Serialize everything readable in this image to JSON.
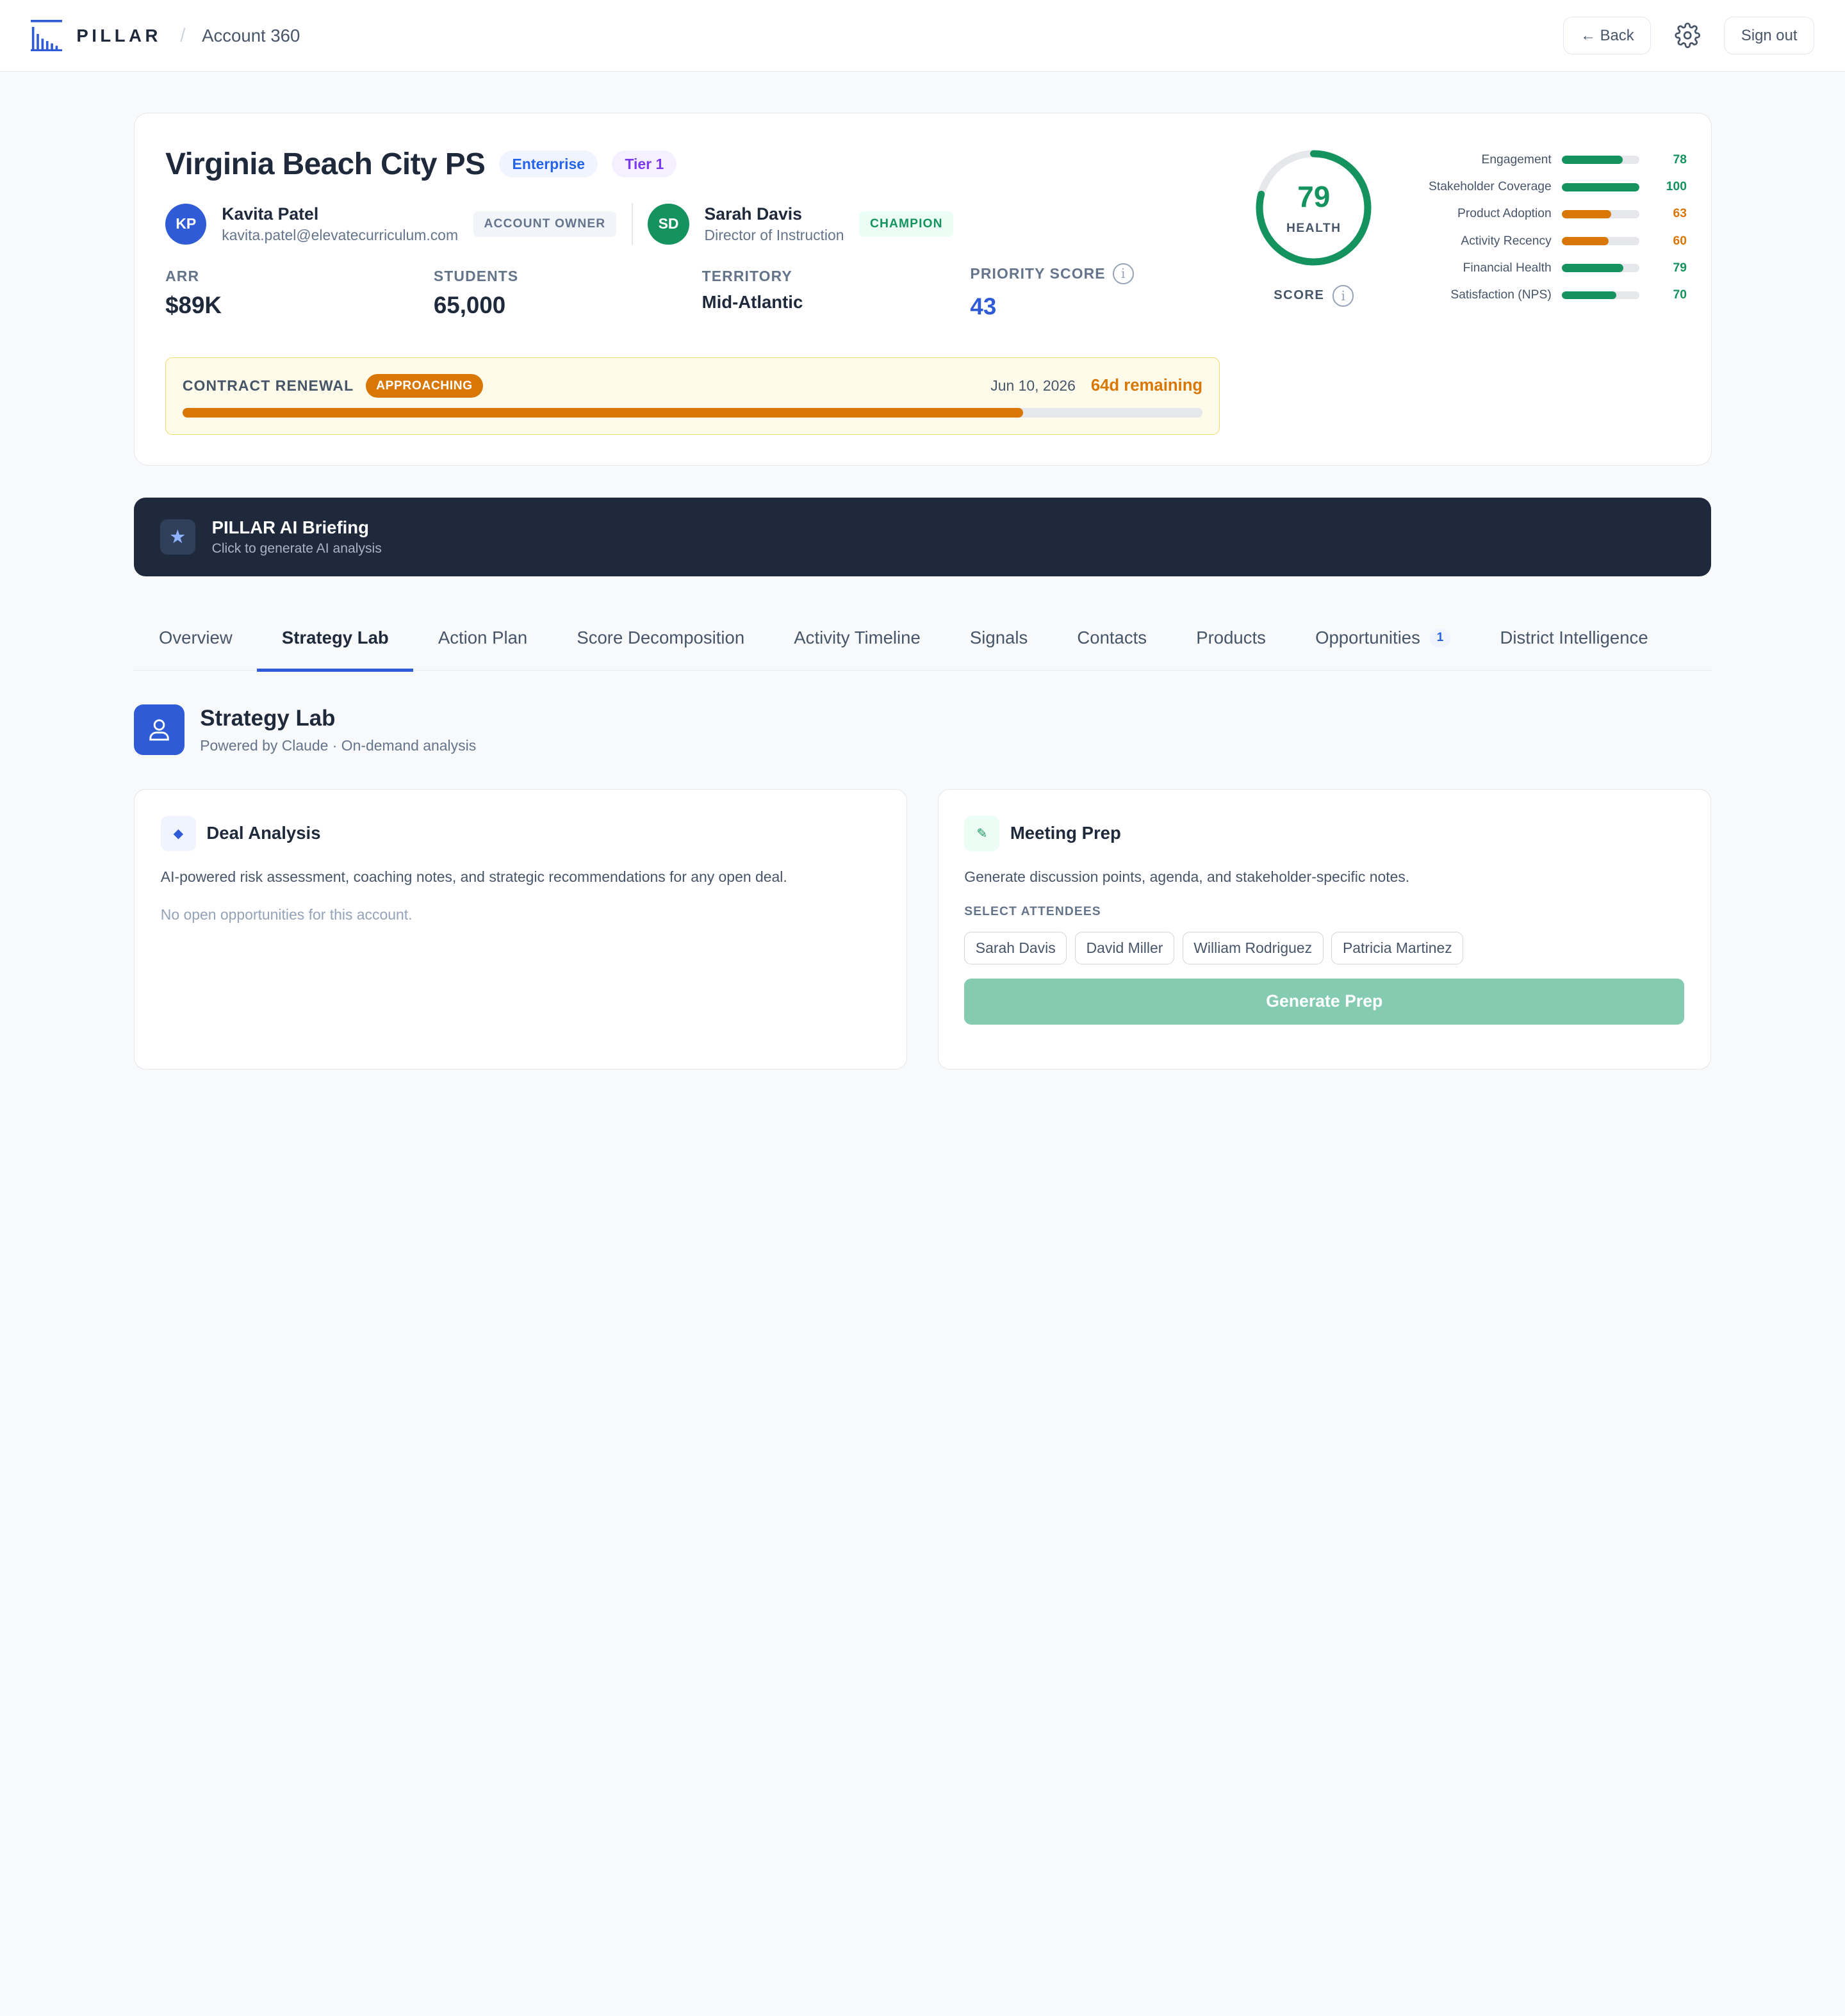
{
  "header": {
    "brand": "PILLAR",
    "separator": "/",
    "breadcrumb": "Account 360",
    "back_label": "← Back",
    "sign_out_label": "Sign out"
  },
  "account": {
    "name": "Virginia Beach City PS",
    "tags": [
      "Enterprise",
      "Tier 1"
    ],
    "owner": {
      "initials": "KP",
      "name": "Kavita Patel",
      "email": "kavita.patel@elevatecurriculum.com",
      "role": "ACCOUNT OWNER"
    },
    "champion": {
      "initials": "SD",
      "name": "Sarah Davis",
      "title": "Director of Instruction",
      "role": "CHAMPION"
    },
    "metrics": {
      "arr_label": "ARR",
      "arr": "$89K",
      "students_label": "STUDENTS",
      "students": "65,000",
      "territory_label": "TERRITORY",
      "territory": "Mid-Atlantic",
      "priority_label": "PRIORITY SCORE",
      "priority": "43"
    },
    "renewal": {
      "label": "CONTRACT RENEWAL",
      "status": "APPROACHING",
      "date": "Jun 10, 2026",
      "remaining": "64d remaining",
      "progress": 0.824
    },
    "health": {
      "score": "79",
      "label": "HEALTH",
      "caption": "SCORE",
      "value": 79,
      "color": "#15935e"
    },
    "factors": [
      {
        "name": "Engagement",
        "value": "78",
        "level": 78,
        "color": "#15935e"
      },
      {
        "name": "Stakeholder Coverage",
        "value": "100",
        "level": 100,
        "color": "#15935e"
      },
      {
        "name": "Product Adoption",
        "value": "63",
        "level": 63,
        "color": "#d97706"
      },
      {
        "name": "Activity Recency",
        "value": "60",
        "level": 60,
        "color": "#d97706"
      },
      {
        "name": "Financial Health",
        "value": "79",
        "level": 79,
        "color": "#15935e"
      },
      {
        "name": "Satisfaction (NPS)",
        "value": "70",
        "level": 70,
        "color": "#15935e"
      }
    ]
  },
  "ai_briefing": {
    "title": "PILLAR AI Briefing",
    "subtitle": "Click to generate AI analysis",
    "icon": "star-icon"
  },
  "tabs": [
    {
      "label": "Overview",
      "active": false
    },
    {
      "label": "Strategy Lab",
      "active": true
    },
    {
      "label": "Action Plan",
      "active": false
    },
    {
      "label": "Score Decomposition",
      "active": false
    },
    {
      "label": "Activity Timeline",
      "active": false
    },
    {
      "label": "Signals",
      "active": false
    },
    {
      "label": "Contacts",
      "active": false
    },
    {
      "label": "Products",
      "active": false
    },
    {
      "label": "Opportunities",
      "active": false,
      "count": "1"
    },
    {
      "label": "District Intelligence",
      "active": false
    }
  ],
  "strategy_lab": {
    "title": "Strategy Lab",
    "subtitle": "Powered by Claude · On-demand analysis",
    "deal_analysis": {
      "title": "Deal Analysis",
      "description": "AI-powered risk assessment, coaching notes, and strategic recommendations for any open deal.",
      "empty": "No open opportunities for this account."
    },
    "meeting_prep": {
      "title": "Meeting Prep",
      "description": "Generate discussion points, agenda, and stakeholder-specific notes.",
      "attendees_label": "SELECT ATTENDEES",
      "attendees": [
        "Sarah Davis",
        "David Miller",
        "William Rodriguez",
        "Patricia Martinez"
      ],
      "button_label": "Generate Prep"
    }
  },
  "colors": {
    "accent": "#2f5bd6",
    "success": "#15935e",
    "warning": "#d97706",
    "dark": "#1e293b"
  }
}
